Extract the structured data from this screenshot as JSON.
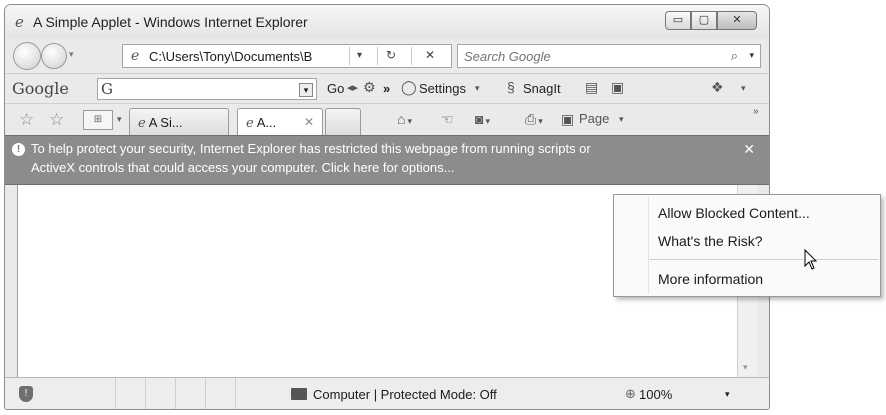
{
  "window": {
    "title": "A Simple Applet - Windows Internet Explorer",
    "title_icon": "ie-logo-icon",
    "caption_buttons": {
      "minimize": "▭",
      "maximize": "▢",
      "close": "✕"
    }
  },
  "address_bar": {
    "url": "C:\\Users\\Tony\\Documents\\B",
    "dropdown": "▾",
    "refresh": "↻",
    "stop": "✕"
  },
  "search": {
    "placeholder": "Search Google",
    "icon": "search-icon"
  },
  "google_toolbar": {
    "logo": "Google",
    "input_icon": "G",
    "go_label": "Go",
    "more": "»",
    "settings_label": "Settings",
    "snagit_label": "SnagIt"
  },
  "tabs": {
    "items": [
      {
        "label": "A Si..."
      },
      {
        "label": "A..."
      }
    ],
    "page_label": "Page",
    "overflow": "»"
  },
  "info_bar": {
    "line1": "To help protect your security, Internet Explorer has restricted this webpage from running scripts or",
    "line2": "ActiveX controls that could access your computer. Click here for options...",
    "close": "✕"
  },
  "context_menu": {
    "items": [
      {
        "label": "Allow Blocked Content..."
      },
      {
        "label": "What's the Risk?"
      },
      {
        "label": "More information"
      }
    ]
  },
  "status_bar": {
    "zone_text": "Computer | Protected Mode: Off",
    "zoom": "100%"
  }
}
